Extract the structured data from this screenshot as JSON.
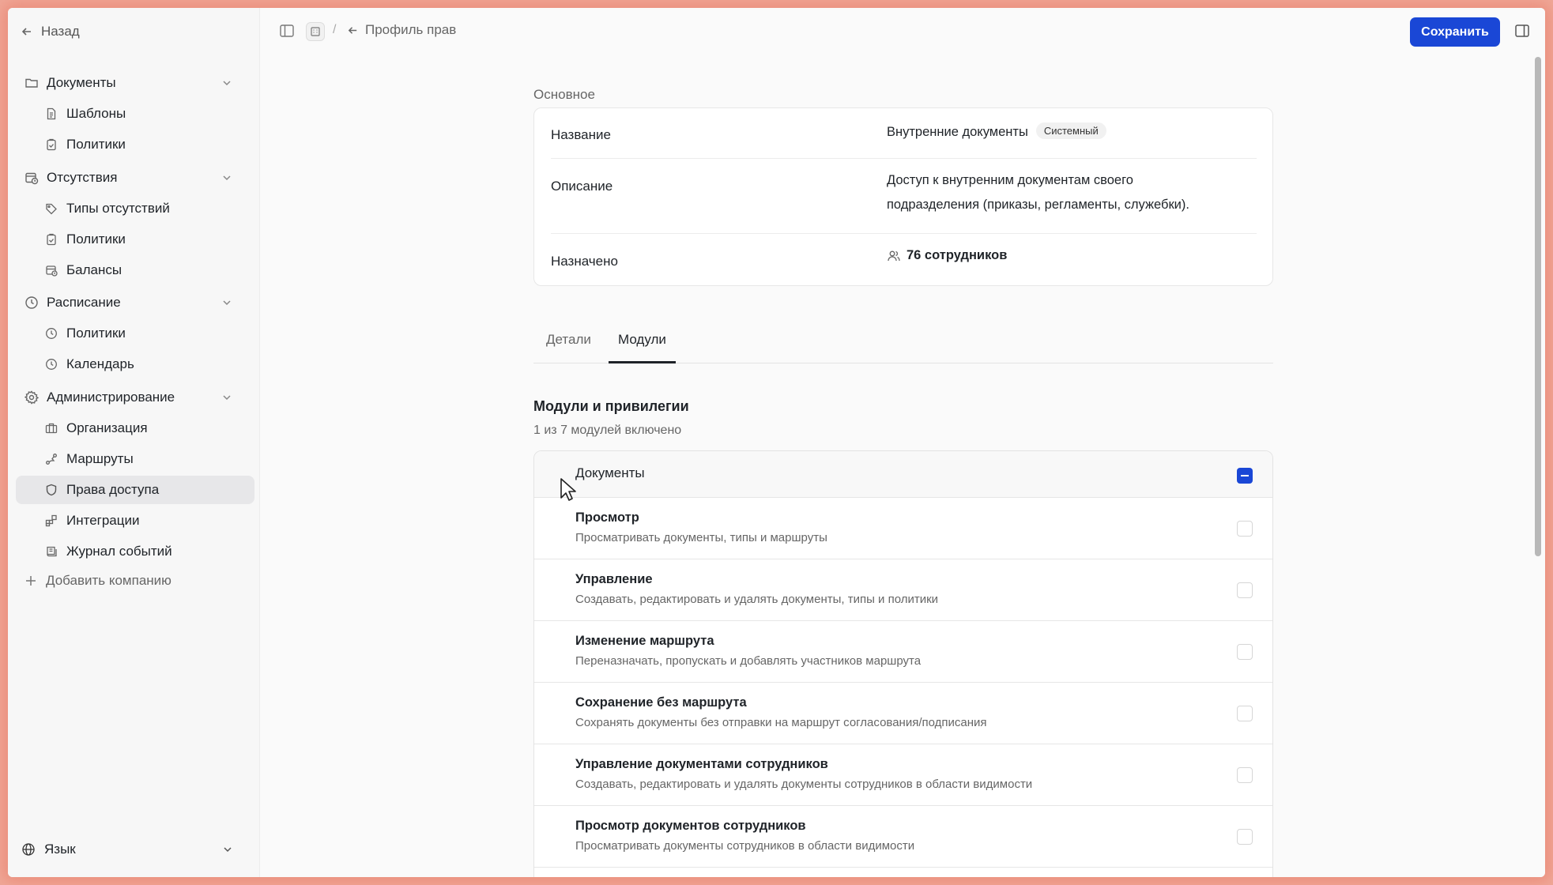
{
  "sidebar": {
    "back_label": "Назад",
    "groups": [
      {
        "label": "Документы",
        "items": [
          {
            "label": "Шаблоны"
          },
          {
            "label": "Политики"
          }
        ]
      },
      {
        "label": "Отсутствия",
        "items": [
          {
            "label": "Типы отсутствий"
          },
          {
            "label": "Политики"
          },
          {
            "label": "Балансы"
          }
        ]
      },
      {
        "label": "Расписание",
        "items": [
          {
            "label": "Политики"
          },
          {
            "label": "Календарь"
          }
        ]
      },
      {
        "label": "Администрирование",
        "items": [
          {
            "label": "Организация"
          },
          {
            "label": "Маршруты"
          },
          {
            "label": "Права доступа"
          },
          {
            "label": "Интеграции"
          },
          {
            "label": "Журнал событий"
          }
        ]
      }
    ],
    "add_company_label": "Добавить компанию",
    "language_label": "Язык"
  },
  "header": {
    "separator": "/",
    "breadcrumb": "Профиль прав",
    "save_label": "Сохранить"
  },
  "basic": {
    "section_label": "Основное",
    "name_label": "Название",
    "name_value": "Внутренние документы",
    "badge": "Системный",
    "description_label": "Описание",
    "description_value": "Доступ к внутренним документам своего подразделения (приказы, регламенты, служебки).",
    "assigned_label": "Назначено",
    "assigned_value": "76 сотрудников"
  },
  "tabs": [
    {
      "label": "Детали",
      "active": false
    },
    {
      "label": "Модули",
      "active": true
    }
  ],
  "modules": {
    "title": "Модули и привилегии",
    "subtitle": "1 из 7 модулей включено",
    "module_name": "Документы",
    "privileges": [
      {
        "title": "Просмотр",
        "description": "Просматривать документы, типы и маршруты",
        "checked": false
      },
      {
        "title": "Управление",
        "description": "Создавать, редактировать и удалять документы, типы и политики",
        "checked": false
      },
      {
        "title": "Изменение маршрута",
        "description": "Переназначать, пропускать и добавлять участников маршрута",
        "checked": false
      },
      {
        "title": "Сохранение без маршрута",
        "description": "Сохранять документы без отправки на маршрут согласования/подписания",
        "checked": false
      },
      {
        "title": "Управление документами сотрудников",
        "description": "Создавать, редактировать и удалять документы сотрудников в области видимости",
        "checked": false
      },
      {
        "title": "Просмотр документов сотрудников",
        "description": "Просматривать документы сотрудников в области видимости",
        "checked": false
      }
    ]
  },
  "colors": {
    "accent": "#1a47d6",
    "active_nav": "#e7e7e9"
  },
  "icons": [
    "arrow-left-icon",
    "folder-icon",
    "file-icon",
    "clipboard-icon",
    "calendar-clock-icon",
    "tag-icon",
    "clock-icon",
    "gear-icon",
    "building-icon",
    "route-icon",
    "shield-icon",
    "integrations-icon",
    "journal-icon",
    "plus-icon",
    "globe-icon",
    "chevron-down-icon",
    "sidebar-toggle-icon",
    "users-icon",
    "panel-right-icon"
  ]
}
